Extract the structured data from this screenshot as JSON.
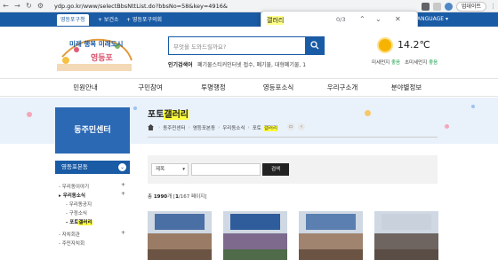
{
  "browser": {
    "url": "ydp.go.kr/www/selectBbsNttList.do?bbsNo=58&key=4916&",
    "update_label": "업데이트",
    "find": {
      "query": "갤러리",
      "count": "0/3"
    }
  },
  "govbar": {
    "tabs": [
      "영등포구청",
      "+ 보건소",
      "+ 영등포구의회"
    ],
    "language": "LANGUAGE ▾"
  },
  "header": {
    "logo_text": "미래 행복 미래도시",
    "logo_sub": "영등포",
    "search_placeholder": "무엇을 도와드릴까요?",
    "hot_label": "인기검색어",
    "hot_text": "폐기물스티커인터넷 접수, 폐기물, 대형폐기물, 1",
    "temperature": "14.2℃",
    "dust": [
      {
        "label": "미세먼지",
        "status": "좋음"
      },
      {
        "label": "초미세먼지",
        "status": "좋음"
      }
    ]
  },
  "nav": [
    "민원안내",
    "구민참여",
    "투명행정",
    "영등포소식",
    "우리구소개",
    "분야별정보"
  ],
  "sidebar": {
    "title": "동주민센터",
    "main_item": "영등포본동",
    "items": [
      {
        "label": "우리동이야기",
        "plus": "+"
      },
      {
        "label": "우리동소식",
        "plus": "+"
      },
      {
        "label": "우리동공지"
      },
      {
        "label": "구정소식"
      },
      {
        "label": "포토",
        "highlight": "갤러리"
      },
      {
        "label": "자치회관",
        "plus": "+"
      },
      {
        "label": "주민자치회"
      }
    ]
  },
  "content": {
    "title_prefix": "포토",
    "title_highlight": "갤러리",
    "breadcrumb": [
      "동주민센터",
      "영등포본동",
      "우리동소식"
    ],
    "breadcrumb_last_prefix": "포토",
    "breadcrumb_last_highlight": "갤러리",
    "filter": {
      "select_value": "제목",
      "search_button": "검색"
    },
    "total_prefix": "총",
    "total_count": "1990",
    "total_mid": "개 [",
    "total_page": "1",
    "total_suffix": "/167 페이지]"
  },
  "colors": {
    "primary": "#1a5ba5",
    "highlight": "#ffff3a"
  }
}
